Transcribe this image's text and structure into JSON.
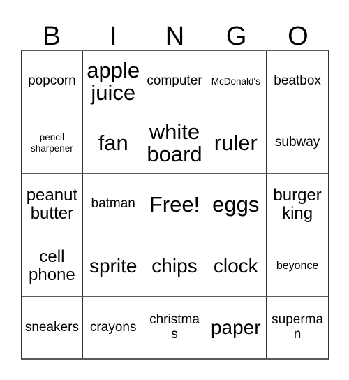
{
  "card": {
    "title": "BINGO",
    "headers": [
      "B",
      "I",
      "N",
      "G",
      "O"
    ],
    "free_space_label": "Free!",
    "grid": [
      [
        {
          "label": "popcorn",
          "size": "md"
        },
        {
          "label": "apple juice",
          "size": "xxl"
        },
        {
          "label": "computer",
          "size": "md"
        },
        {
          "label": "McDonald's",
          "size": "xs"
        },
        {
          "label": "beatbox",
          "size": "md"
        }
      ],
      [
        {
          "label": "pencil sharpener",
          "size": "xs"
        },
        {
          "label": "fan",
          "size": "xxl"
        },
        {
          "label": "white board",
          "size": "xxl"
        },
        {
          "label": "ruler",
          "size": "xxl"
        },
        {
          "label": "subway",
          "size": "md"
        }
      ],
      [
        {
          "label": "peanut butter",
          "size": "lg"
        },
        {
          "label": "batman",
          "size": "md"
        },
        {
          "label": "Free!",
          "size": "xxl"
        },
        {
          "label": "eggs",
          "size": "xxl"
        },
        {
          "label": "burger king",
          "size": "lg"
        }
      ],
      [
        {
          "label": "cell phone",
          "size": "lg"
        },
        {
          "label": "sprite",
          "size": "xl"
        },
        {
          "label": "chips",
          "size": "xl"
        },
        {
          "label": "clock",
          "size": "xl"
        },
        {
          "label": "beyonce",
          "size": "sm"
        }
      ],
      [
        {
          "label": "sneakers",
          "size": "md"
        },
        {
          "label": "crayons",
          "size": "md"
        },
        {
          "label": "christmas",
          "size": "md"
        },
        {
          "label": "paper",
          "size": "xl"
        },
        {
          "label": "superman",
          "size": "md"
        }
      ]
    ]
  },
  "colors": {
    "background": "#ffffff",
    "text": "#000000",
    "grid_line": "#333333",
    "grid_line_soft": "#5a5a5a"
  }
}
